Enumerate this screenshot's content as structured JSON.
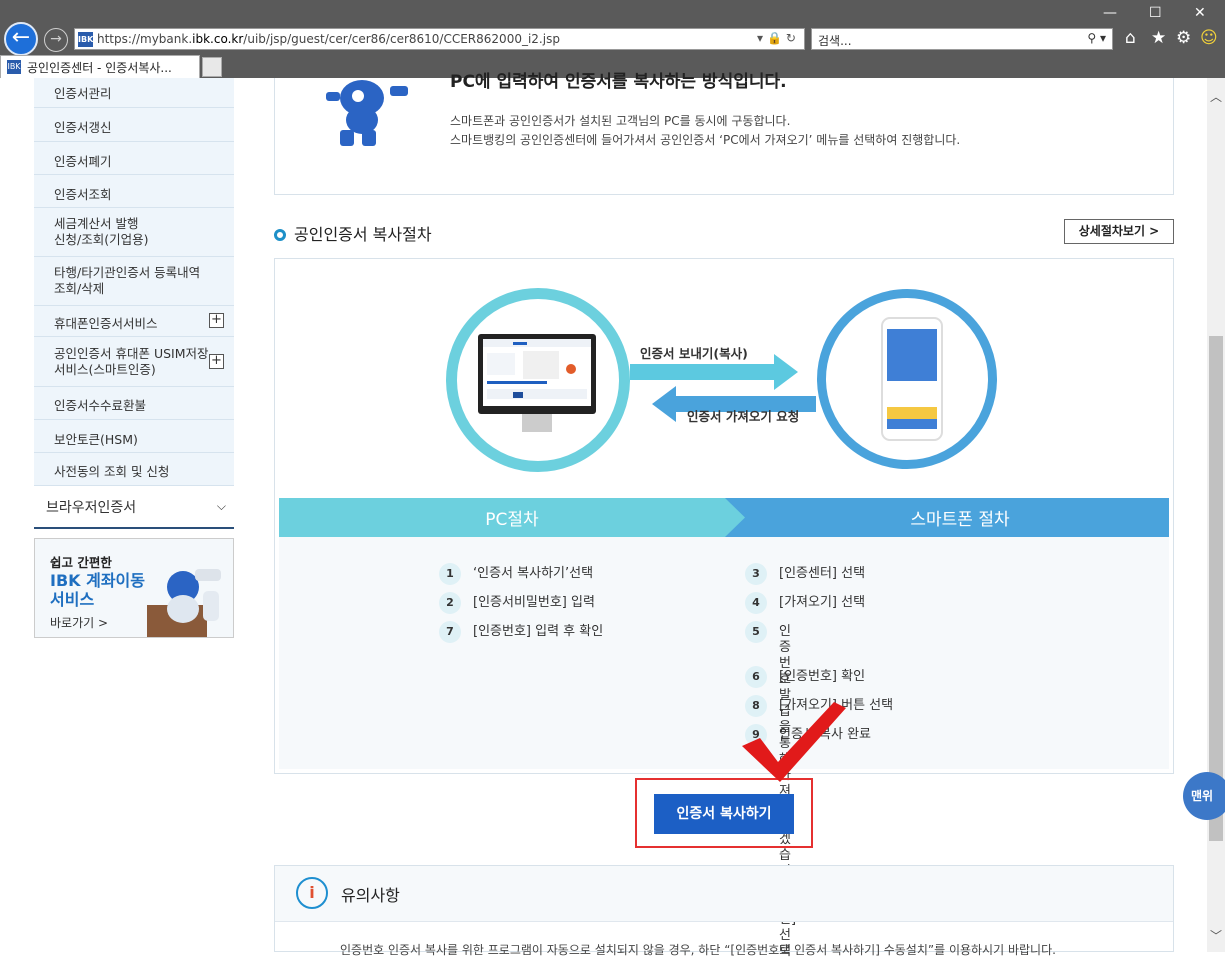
{
  "browser": {
    "url_prefix": "https://mybank.",
    "url_domain": "ibk.co.kr",
    "url_path": "/uib/jsp/guest/cer/cer86/cer8610/CCER862000_i2.jsp",
    "search_placeholder": "검색...",
    "tab_title": "공인인증센터 - 인증서복사...",
    "favicon_text": "IBK"
  },
  "sidebar": {
    "items": [
      {
        "label": "인증서관리"
      },
      {
        "label": "인증서갱신"
      },
      {
        "label": "인증서폐기"
      },
      {
        "label": "인증서조회"
      },
      {
        "label": "세금계산서 발행\n신청/조회(기업용)"
      },
      {
        "label": "타행/타기관인증서 등록내역\n조회/삭제"
      },
      {
        "label": "휴대폰인증서서비스",
        "plus": "+"
      },
      {
        "label": "공인인증서 휴대폰 USIM저장\n서비스(스마트인증)",
        "plus": "+"
      },
      {
        "label": "인증서수수료환불"
      },
      {
        "label": "보안토큰(HSM)"
      },
      {
        "label": "사전동의 조회 및 신청"
      }
    ],
    "browser_cert": "브라우저인증서",
    "banner": {
      "line1": "쉽고 간편한",
      "line2": "IBK 계좌이동 서비스",
      "link": "바로가기 >"
    }
  },
  "intro": {
    "heading": "PC에 입력하여 인증서를 복사하는 방식입니다.",
    "line1": "스마트폰과 공인인증서가 설치된 고객님의 PC를 동시에 구동합니다.",
    "line2": "스마트뱅킹의 공인인증센터에 들어가셔서 공인인증서 ‘PC에서 가져오기’ 메뉴를 선택하여 진행합니다."
  },
  "procedure": {
    "title": "공인인증서 복사절차",
    "detail_button": "상세절차보기 >",
    "send_label": "인증서 보내기(복사)",
    "receive_label": "인증서 가져오기 요청",
    "pc_band": "PC절차",
    "smartphone_band": "스마트폰 절차",
    "pc_steps": [
      {
        "num": "1",
        "text": "‘인증서 복사하기’선택"
      },
      {
        "num": "2",
        "text": "[인증서비밀번호] 입력"
      },
      {
        "num": "7",
        "text": "[인증번호] 입력 후 확인"
      }
    ],
    "phone_steps": [
      {
        "num": "3",
        "text": "[인증센터] 선택"
      },
      {
        "num": "4",
        "text": "[가져오기] 선택"
      },
      {
        "num": "5",
        "text": "인증번호 발급을 통해 가져오시겠습니까?\n[확인] 선택"
      },
      {
        "num": "6",
        "text": "[인증번호] 확인"
      },
      {
        "num": "8",
        "text": "[가져오기] 버튼 선택"
      },
      {
        "num": "9",
        "text": "인증서 복사 완료"
      }
    ],
    "copy_button": "인증서 복사하기"
  },
  "notice": {
    "title": "유의사항",
    "text": "인증번호 인증서 복사를 위한 프로그램이 자동으로 설치되지 않을 경우, 하단 “[인증번호로 인증서 복사하기] 수동설치”를 이용하시기 바랍니다."
  },
  "float_button": "맨위",
  "colors": {
    "accent": "#1c5fc5",
    "pc_teal": "#6cd0de",
    "phone_blue": "#4aa3dc",
    "highlight_red": "#e53030"
  }
}
